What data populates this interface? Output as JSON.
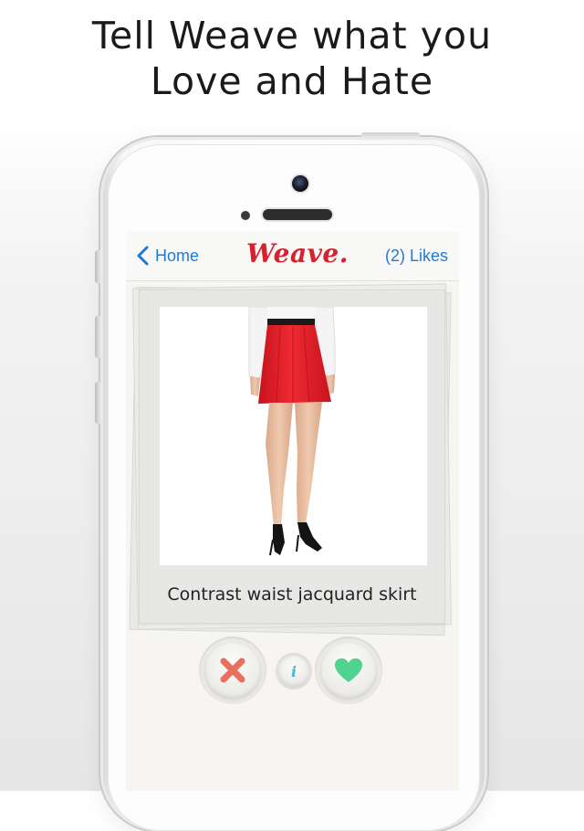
{
  "headline": {
    "line1": "Tell Weave what you",
    "line2": "Love and Hate"
  },
  "navbar": {
    "back_label": "Home",
    "logo_text": "Weave.",
    "likes_label": "(2) Likes"
  },
  "card": {
    "caption": "Contrast waist jacquard skirt"
  },
  "actions": {
    "dislike_icon": "x-icon",
    "info_icon": "info-icon",
    "like_icon": "heart-icon",
    "info_glyph": "i"
  },
  "colors": {
    "accent_blue": "#1f7ad7",
    "logo_red": "#d9202e",
    "dislike_red": "#e8705c",
    "like_green": "#4fd38e"
  }
}
